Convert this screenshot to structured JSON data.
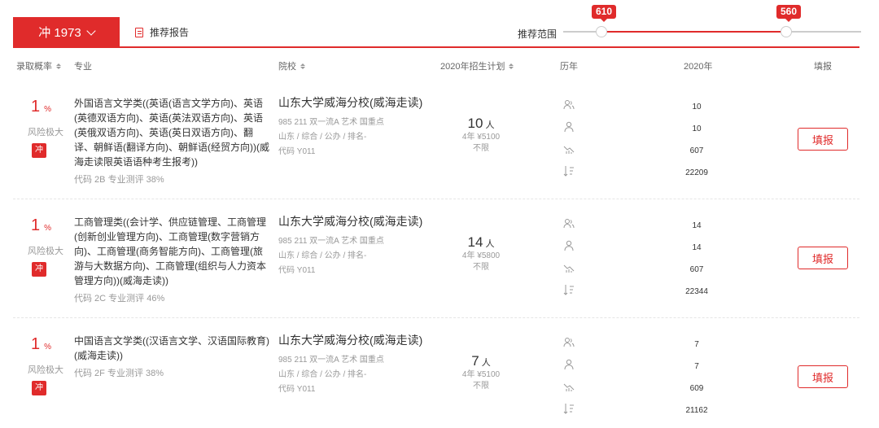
{
  "header": {
    "risk_tab_label": "冲 1973",
    "report_label": "推荐报告",
    "range_label": "推荐范围",
    "range_low": "610",
    "range_high": "560"
  },
  "columns": {
    "probability": "录取概率",
    "major": "专业",
    "school": "院校",
    "plan": "2020年招生计划",
    "history": "历年",
    "year": "2020年",
    "action": "填报"
  },
  "rows": [
    {
      "prob_value": "1",
      "prob_unit": "%",
      "risk": "风险极大",
      "badge": "冲",
      "major": "外国语言文学类((英语(语言文学方向)、英语(英德双语方向)、英语(英法双语方向)、英语(英俄双语方向)、英语(英日双语方向)、翻译、朝鲜语(翻译方向)、朝鲜语(经贸方向))(威海走读限英语语种考生报考))",
      "code_line": "代码 2B   专业测评 38%",
      "school": "山东大学威海分校(威海走读)",
      "tags": "985 211 双一流A 艺术 国重点",
      "location": "山东 / 综合 / 公办 / 排名-",
      "school_code": "代码 Y011",
      "plan_num": "10",
      "plan_unit": "人",
      "plan_fee": "4年  ¥5100",
      "plan_limit": "不限",
      "stats": [
        "10",
        "10",
        "607",
        "22209"
      ],
      "action": "填报"
    },
    {
      "prob_value": "1",
      "prob_unit": "%",
      "risk": "风险极大",
      "badge": "冲",
      "major": "工商管理类((会计学、供应链管理、工商管理(创新创业管理方向)、工商管理(数字营销方向)、工商管理(商务智能方向)、工商管理(旅游与大数据方向)、工商管理(组织与人力资本管理方向))(威海走读))",
      "code_line": "代码 2C   专业测评 46%",
      "school": "山东大学威海分校(威海走读)",
      "tags": "985 211 双一流A 艺术 国重点",
      "location": "山东 / 综合 / 公办 / 排名-",
      "school_code": "代码 Y011",
      "plan_num": "14",
      "plan_unit": "人",
      "plan_fee": "4年  ¥5800",
      "plan_limit": "不限",
      "stats": [
        "14",
        "14",
        "607",
        "22344"
      ],
      "action": "填报"
    },
    {
      "prob_value": "1",
      "prob_unit": "%",
      "risk": "风险极大",
      "badge": "冲",
      "major": "中国语言文学类((汉语言文学、汉语国际教育)(威海走读))",
      "code_line": "代码 2F   专业测评 38%",
      "school": "山东大学威海分校(威海走读)",
      "tags": "985 211 双一流A 艺术 国重点",
      "location": "山东 / 综合 / 公办 / 排名-",
      "school_code": "代码 Y011",
      "plan_num": "7",
      "plan_unit": "人",
      "plan_fee": "4年  ¥5100",
      "plan_limit": "不限",
      "stats": [
        "7",
        "7",
        "609",
        "21162"
      ],
      "action": "填报"
    }
  ],
  "colors": {
    "accent": "#e02b2b",
    "muted": "#999999",
    "text": "#333333"
  },
  "icons": [
    "users-icon",
    "person-icon",
    "trend-chart-icon",
    "rank-sort-icon"
  ]
}
